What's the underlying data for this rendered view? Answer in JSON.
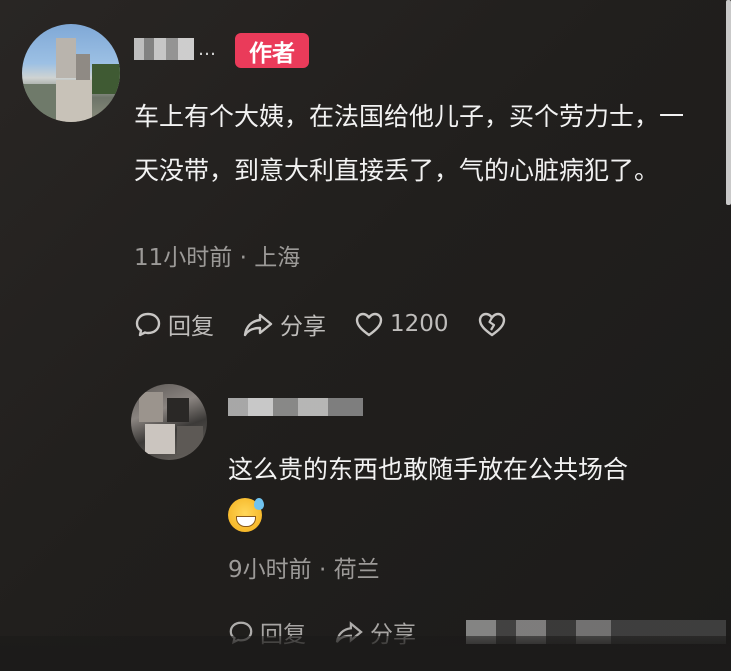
{
  "comment": {
    "author_badge": "作者",
    "text": "车上有个大姨，在法国给他儿子，买个劳力士，一天没带，到意大利直接丢了，气的心脏病犯了。",
    "time": "11小时前",
    "location": "上海",
    "actions": {
      "reply_label": "回复",
      "share_label": "分享",
      "like_count": "1200"
    }
  },
  "reply": {
    "text": "这么贵的东西也敢随手放在公共场合",
    "time": "9小时前",
    "location": "荷兰",
    "actions": {
      "reply_label": "回复",
      "share_label": "分享"
    }
  },
  "icons": {
    "reply": "speech-bubble-icon",
    "share": "share-arrow-icon",
    "like": "heart-icon",
    "dislike": "broken-heart-icon",
    "emoji": "grinning-sweat-emoji"
  },
  "colors": {
    "badge": "#ea3b5a",
    "text": "#f2f2f2",
    "meta": "#9c9a98"
  }
}
